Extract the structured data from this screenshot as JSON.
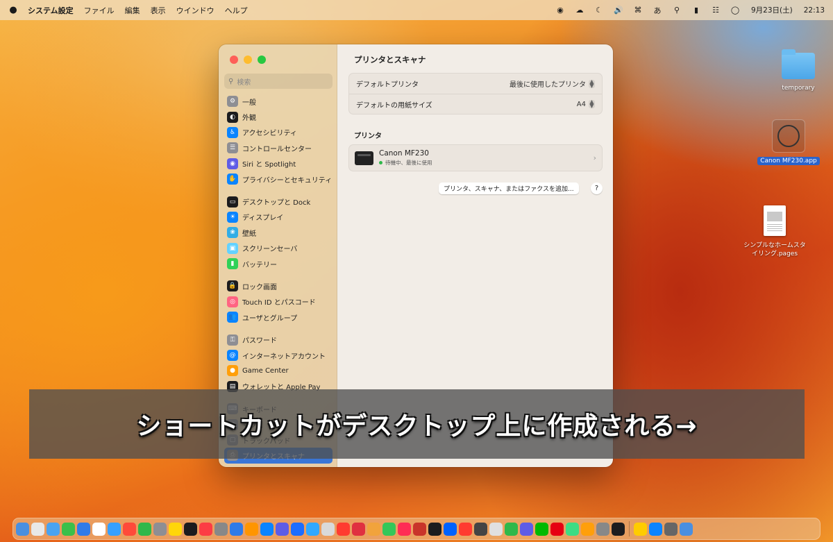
{
  "menubar": {
    "app_name": "システム設定",
    "menus": [
      "ファイル",
      "編集",
      "表示",
      "ウインドウ",
      "ヘルプ"
    ],
    "ime": "あ",
    "clock_date": "9月23日(土)",
    "clock_time": "22:13"
  },
  "window": {
    "search_placeholder": "検索",
    "sidebar_groups": [
      [
        {
          "label": "一般",
          "icon": "gear-icon",
          "color": "#8e8e93"
        },
        {
          "label": "外観",
          "icon": "appearance-icon",
          "color": "#1c1c1e"
        },
        {
          "label": "アクセシビリティ",
          "icon": "accessibility-icon",
          "color": "#0a84ff"
        },
        {
          "label": "コントロールセンター",
          "icon": "control-center-icon",
          "color": "#8e8e93"
        },
        {
          "label": "Siri と Spotlight",
          "icon": "siri-icon",
          "color": "#5e5ce6"
        },
        {
          "label": "プライバシーとセキュリティ",
          "icon": "hand-icon",
          "color": "#0a84ff"
        }
      ],
      [
        {
          "label": "デスクトップと Dock",
          "icon": "dock-icon",
          "color": "#1c1c1e"
        },
        {
          "label": "ディスプレイ",
          "icon": "display-icon",
          "color": "#0a84ff"
        },
        {
          "label": "壁紙",
          "icon": "wallpaper-icon",
          "color": "#32ade6"
        },
        {
          "label": "スクリーンセーバ",
          "icon": "screensaver-icon",
          "color": "#64d2ff"
        },
        {
          "label": "バッテリー",
          "icon": "battery-icon",
          "color": "#30d158"
        }
      ],
      [
        {
          "label": "ロック画面",
          "icon": "lock-icon",
          "color": "#1c1c1e"
        },
        {
          "label": "Touch ID とパスコード",
          "icon": "fingerprint-icon",
          "color": "#ff6482"
        },
        {
          "label": "ユーザとグループ",
          "icon": "users-icon",
          "color": "#0a84ff"
        }
      ],
      [
        {
          "label": "パスワード",
          "icon": "key-icon",
          "color": "#8e8e93"
        },
        {
          "label": "インターネットアカウント",
          "icon": "at-icon",
          "color": "#0a84ff"
        },
        {
          "label": "Game Center",
          "icon": "game-center-icon",
          "color": "#ff9f0a"
        },
        {
          "label": "ウォレットと Apple Pay",
          "icon": "wallet-icon",
          "color": "#1c1c1e"
        }
      ],
      [
        {
          "label": "キーボード",
          "icon": "keyboard-icon",
          "color": "#8e8e93"
        },
        {
          "label": "マウス",
          "icon": "mouse-icon",
          "color": "#8e8e93"
        },
        {
          "label": "トラックパッド",
          "icon": "trackpad-icon",
          "color": "#8e8e93"
        },
        {
          "label": "プリンタとスキャナ",
          "icon": "printer-icon",
          "color": "#8e8e93",
          "selected": true
        }
      ]
    ],
    "content": {
      "title": "プリンタとスキャナ",
      "default_printer_label": "デフォルトプリンタ",
      "default_printer_value": "最後に使用したプリンタ",
      "default_paper_label": "デフォルトの用紙サイズ",
      "default_paper_value": "A4",
      "printers_section": "プリンタ",
      "printer_name": "Canon MF230",
      "printer_status": "待機中、最後に使用",
      "add_button": "プリンタ、スキャナ、またはファクスを追加...",
      "help_button": "?"
    }
  },
  "desktop": {
    "folder_label": "temporary",
    "app_label": "Canon MF230.app",
    "doc_label_line1": "シンプルなホームスタ",
    "doc_label_line2": "イリング.pages"
  },
  "caption": "ショートカットがデスクトップ上に作成される→",
  "dock_colors": [
    "#4a8fe0",
    "#e8e8e8",
    "#4aa3f0",
    "#3ac04a",
    "#2f7be8",
    "#fff",
    "#36a0ff",
    "#ff4a3a",
    "#2fb84a",
    "#8e8e93",
    "#ffd60a",
    "#1c1c1e",
    "#fc3c44",
    "#888",
    "#2f7be8",
    "#ff9500",
    "#0a84ff",
    "#5e5ce6",
    "#1d6dff",
    "#31a8ff",
    "#d9d9d9",
    "#ff3b30",
    "#e03040",
    "#f1a33c",
    "#34c759",
    "#ff2d55",
    "#c9342a",
    "#1c1c1e",
    "#0062ff",
    "#ff3b30",
    "#444",
    "#e0e0e0",
    "#2fb84a",
    "#5e5ce6",
    "#00b900",
    "#e60012",
    "#3ddc84",
    "#ff9f0a",
    "#888",
    "#1c1c1e",
    "#ffcc00",
    "#0a84ff",
    "#666",
    "#4a8fe0"
  ]
}
